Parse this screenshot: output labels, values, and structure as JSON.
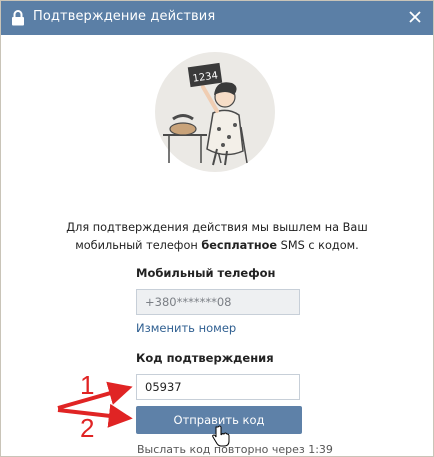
{
  "dialog": {
    "title": "Подтверждение действия",
    "illustration_sign": "1234"
  },
  "info": {
    "part1": "Для подтверждения действия мы вышлем на Ваш мобильный телефон ",
    "bold": "бесплатное",
    "part2": " SMS с кодом."
  },
  "phone": {
    "label": "Мобильный телефон",
    "value": "+380*******08",
    "change_link": "Изменить номер"
  },
  "code": {
    "label": "Код подтверждения",
    "value": "05937"
  },
  "submit_label": "Отправить код",
  "resend_text": "Выслать код повторно через 1:39",
  "annotations": {
    "one": "1",
    "two": "2",
    "color": "#e02424"
  },
  "colors": {
    "titlebar": "#5b7fa6",
    "button": "#5e81a8",
    "link": "#2f5f91"
  }
}
